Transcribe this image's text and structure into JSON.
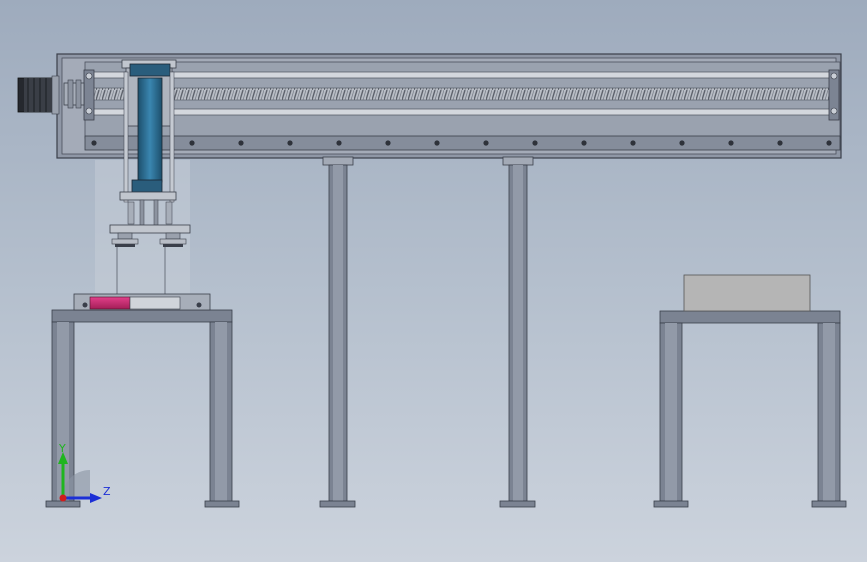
{
  "viewport": {
    "background_top": "#9eabbd",
    "background_bottom": "#ccd3dd"
  },
  "model": {
    "frame_color": "#6b7384",
    "frame_dark": "#3a3f4a",
    "rail_color": "#c9ced6",
    "screw_color": "#8a909a",
    "cylinder_color": "#2f6f94",
    "gripper_pad_color": "#c02a6a",
    "box_color": "#b5b5b5"
  },
  "triad": {
    "y_label": "Y",
    "z_label": "Z",
    "y_color": "#1fb51f",
    "z_color": "#1c2fd6",
    "x_color": "#d01c1c"
  }
}
